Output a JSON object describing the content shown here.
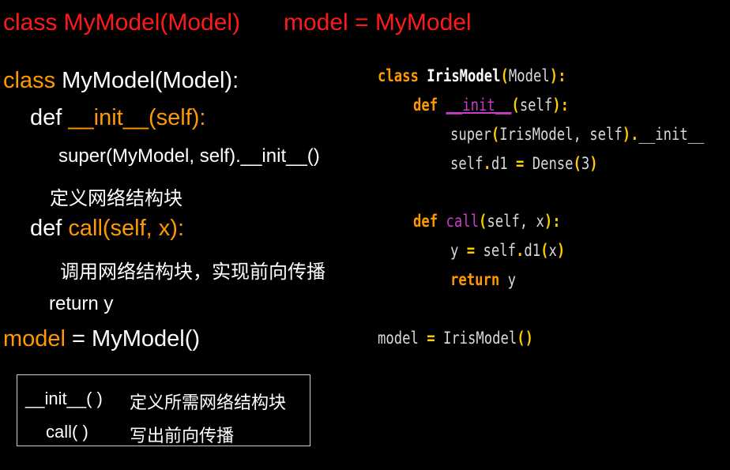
{
  "title": {
    "part1": "class MyModel(Model)",
    "part2": "model = MyModel"
  },
  "left_code": {
    "line1": "class MyModel(Model):",
    "line2_def": "def ",
    "line2_init": "__init__(self):",
    "line3": "super(MyModel, self).__init__()",
    "line4": "定义网络结构块",
    "line5_def": "def ",
    "line5_call": "call(self, x):",
    "line6": "调用网络结构块，实现前向传播",
    "line7": "return y",
    "line8_model": "model",
    "line8_rest": " = MyModel()"
  },
  "right_code": {
    "l1_class": "class",
    "l1_name": "IrisModel",
    "l1_p1": "(",
    "l1_base": "Model",
    "l1_p2": "):",
    "l2_def": "def",
    "l2_init": "__init__",
    "l2_p1": "(",
    "l2_self": "self",
    "l2_p2": "):",
    "l3_super": "super",
    "l3_p1": "(",
    "l3_args": "IrisModel, self",
    "l3_p2": ").",
    "l3_init": "__init__",
    "l4_self": "self",
    "l4_dot": ".",
    "l4_d1": "d1",
    "l4_eq": " = ",
    "l4_dense": "Dense",
    "l4_p1": "(",
    "l4_num": "3",
    "l4_p2": ")",
    "l6_def": "def",
    "l6_call": "call",
    "l6_p1": "(",
    "l6_args": "self, x",
    "l6_p2": "):",
    "l7_y": "y",
    "l7_eq": " = ",
    "l7_self": "self",
    "l7_dot": ".",
    "l7_d1": "d1",
    "l7_p1": "(",
    "l7_x": "x",
    "l7_p2": ")",
    "l8_return": "return",
    "l8_y": " y",
    "l10_model": "model",
    "l10_eq": " = ",
    "l10_iris": "IrisModel",
    "l10_paren": "()"
  },
  "info_box": {
    "row1_key": "__init__( )",
    "row1_desc": "定义所需网络结构块",
    "row2_key": "call( )",
    "row2_desc": "写出前向传播"
  },
  "colors": {
    "background": "#000000",
    "title_red": "#ff1a1a",
    "keyword_orange": "#ff9900",
    "magenta": "#c83cc8",
    "punct_yellow": "#ffcc00"
  }
}
